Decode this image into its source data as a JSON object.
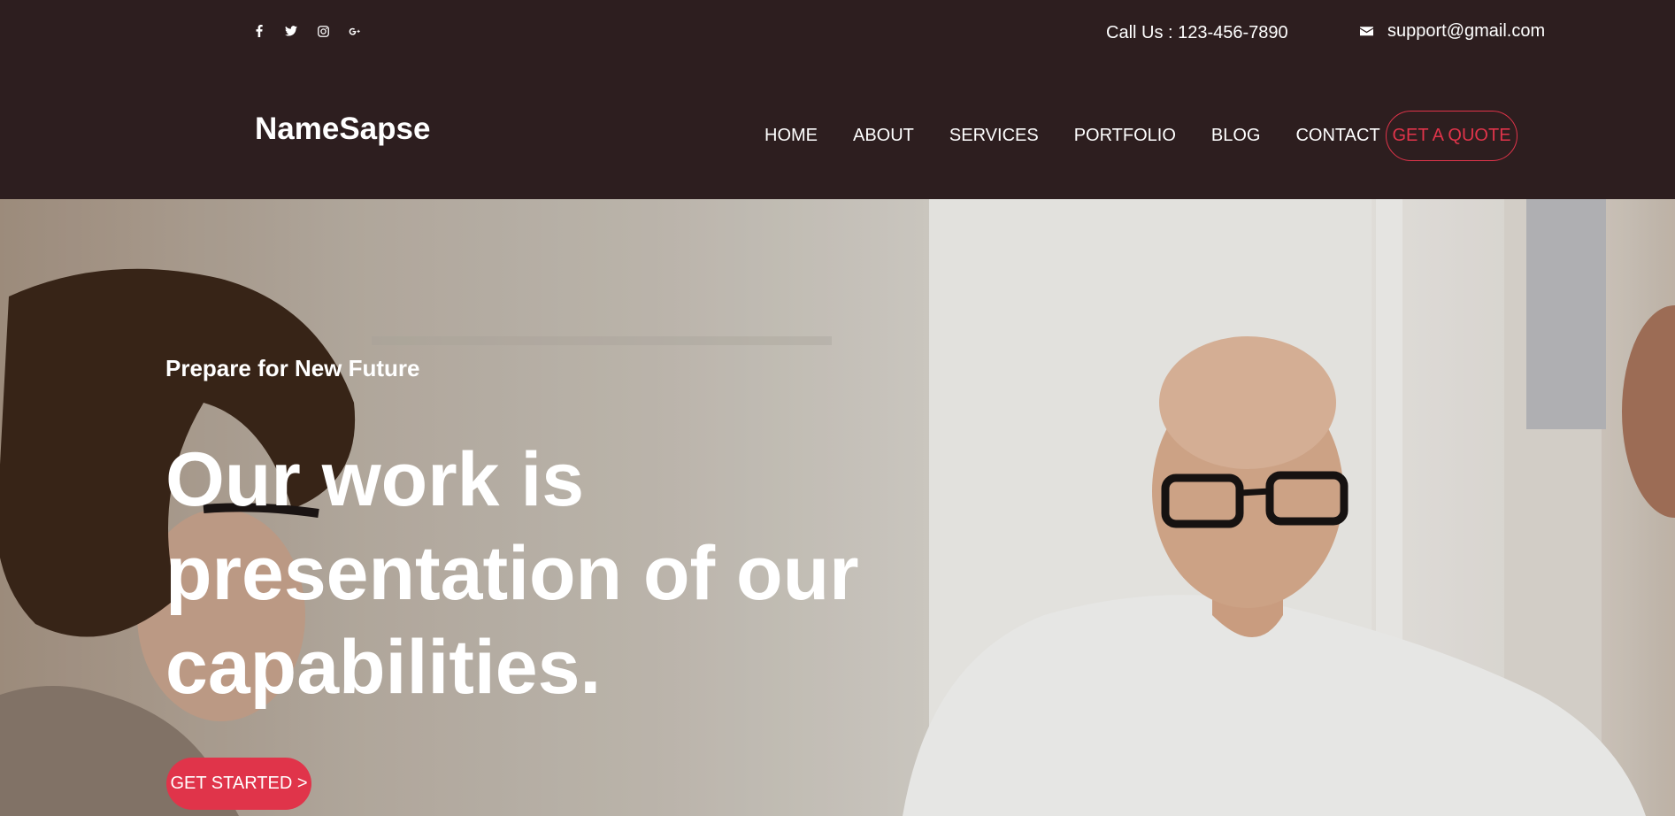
{
  "topbar": {
    "social": [
      {
        "icon": "facebook-icon"
      },
      {
        "icon": "twitter-icon"
      },
      {
        "icon": "instagram-icon"
      },
      {
        "icon": "google-plus-icon"
      }
    ],
    "call": "Call Us : 123-456-7890",
    "email": "support@gmail.com",
    "email_icon": "envelope-icon"
  },
  "header": {
    "logo": "NameSapse",
    "nav": [
      "HOME",
      "ABOUT",
      "SERVICES",
      "PORTFOLIO",
      "BLOG",
      "CONTACT"
    ],
    "quote_button": "GET A QUOTE"
  },
  "hero": {
    "kicker": "Prepare for New Future",
    "title_lines": [
      "Our work is",
      "presentation of our",
      "capabilities."
    ],
    "cta": "GET STARTED >"
  },
  "colors": {
    "header_bg": "#2d1e1f",
    "accent": "#e0344a",
    "text_light": "#ffffff"
  }
}
